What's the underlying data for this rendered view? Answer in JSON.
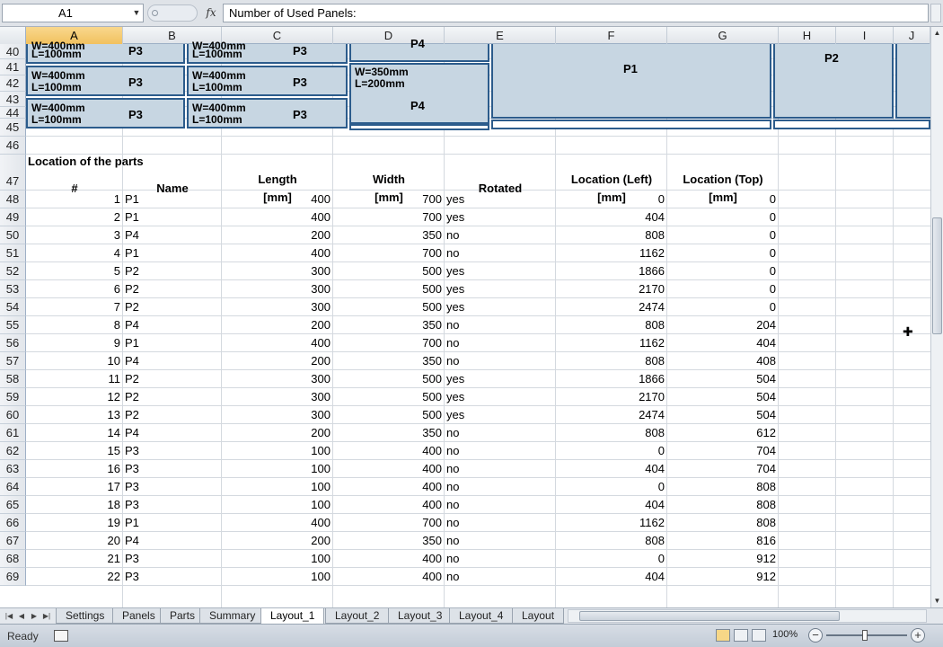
{
  "formula_bar": {
    "name_box": "A1",
    "fx_label": "fx",
    "formula": "Number of Used Panels:"
  },
  "columns": [
    "A",
    "B",
    "C",
    "D",
    "E",
    "F",
    "G",
    "H",
    "I",
    "J"
  ],
  "row_numbers": [
    "40",
    "41",
    "42",
    "43",
    "44",
    "45",
    "46",
    "47",
    "48",
    "49",
    "50",
    "51",
    "52",
    "53",
    "54",
    "55",
    "56",
    "57",
    "58",
    "59",
    "60",
    "61",
    "62",
    "63",
    "64",
    "65",
    "66",
    "67",
    "68",
    "69"
  ],
  "layout_panels": {
    "p3_dims": "W=400mm\nL=100mm",
    "p3_dims_top": "W=400mm",
    "p3_bottom": "L=100mm",
    "p3_label": "P3",
    "p4_dims": "W=350mm\nL=200mm",
    "p4_label": "P4",
    "p1_label": "P1",
    "p2_label": "P2"
  },
  "table": {
    "section_title": "Location of the parts",
    "headers": {
      "index": "#",
      "name": "Name",
      "length_line1": "Length",
      "length_line2": "[mm]",
      "width_line1": "Width",
      "width_line2": "[mm]",
      "rotated": "Rotated",
      "left_line1": "Location (Left)",
      "left_line2": "[mm]",
      "top_line1": "Location (Top)",
      "top_line2": "[mm]"
    },
    "rows": [
      {
        "n": "1",
        "name": "P1",
        "length": "400",
        "width": "700",
        "rotated": "yes",
        "left": "0",
        "top": "0"
      },
      {
        "n": "2",
        "name": "P1",
        "length": "400",
        "width": "700",
        "rotated": "yes",
        "left": "404",
        "top": "0"
      },
      {
        "n": "3",
        "name": "P4",
        "length": "200",
        "width": "350",
        "rotated": "no",
        "left": "808",
        "top": "0"
      },
      {
        "n": "4",
        "name": "P1",
        "length": "400",
        "width": "700",
        "rotated": "no",
        "left": "1162",
        "top": "0"
      },
      {
        "n": "5",
        "name": "P2",
        "length": "300",
        "width": "500",
        "rotated": "yes",
        "left": "1866",
        "top": "0"
      },
      {
        "n": "6",
        "name": "P2",
        "length": "300",
        "width": "500",
        "rotated": "yes",
        "left": "2170",
        "top": "0"
      },
      {
        "n": "7",
        "name": "P2",
        "length": "300",
        "width": "500",
        "rotated": "yes",
        "left": "2474",
        "top": "0"
      },
      {
        "n": "8",
        "name": "P4",
        "length": "200",
        "width": "350",
        "rotated": "no",
        "left": "808",
        "top": "204"
      },
      {
        "n": "9",
        "name": "P1",
        "length": "400",
        "width": "700",
        "rotated": "no",
        "left": "1162",
        "top": "404"
      },
      {
        "n": "10",
        "name": "P4",
        "length": "200",
        "width": "350",
        "rotated": "no",
        "left": "808",
        "top": "408"
      },
      {
        "n": "11",
        "name": "P2",
        "length": "300",
        "width": "500",
        "rotated": "yes",
        "left": "1866",
        "top": "504"
      },
      {
        "n": "12",
        "name": "P2",
        "length": "300",
        "width": "500",
        "rotated": "yes",
        "left": "2170",
        "top": "504"
      },
      {
        "n": "13",
        "name": "P2",
        "length": "300",
        "width": "500",
        "rotated": "yes",
        "left": "2474",
        "top": "504"
      },
      {
        "n": "14",
        "name": "P4",
        "length": "200",
        "width": "350",
        "rotated": "no",
        "left": "808",
        "top": "612"
      },
      {
        "n": "15",
        "name": "P3",
        "length": "100",
        "width": "400",
        "rotated": "no",
        "left": "0",
        "top": "704"
      },
      {
        "n": "16",
        "name": "P3",
        "length": "100",
        "width": "400",
        "rotated": "no",
        "left": "404",
        "top": "704"
      },
      {
        "n": "17",
        "name": "P3",
        "length": "100",
        "width": "400",
        "rotated": "no",
        "left": "0",
        "top": "808"
      },
      {
        "n": "18",
        "name": "P3",
        "length": "100",
        "width": "400",
        "rotated": "no",
        "left": "404",
        "top": "808"
      },
      {
        "n": "19",
        "name": "P1",
        "length": "400",
        "width": "700",
        "rotated": "no",
        "left": "1162",
        "top": "808"
      },
      {
        "n": "20",
        "name": "P4",
        "length": "200",
        "width": "350",
        "rotated": "no",
        "left": "808",
        "top": "816"
      },
      {
        "n": "21",
        "name": "P3",
        "length": "100",
        "width": "400",
        "rotated": "no",
        "left": "0",
        "top": "912"
      },
      {
        "n": "22",
        "name": "P3",
        "length": "100",
        "width": "400",
        "rotated": "no",
        "left": "404",
        "top": "912"
      }
    ]
  },
  "sheet_tabs": [
    "Settings",
    "Panels",
    "Parts",
    "Summary",
    "Layout_1",
    "Layout_2",
    "Layout_3",
    "Layout_4",
    "Layout"
  ],
  "active_tab": "Layout_1",
  "status_bar": {
    "status": "Ready",
    "zoom": "100%"
  },
  "colors": {
    "panel_fill": "#c7d6e2",
    "panel_border": "#2c5c8c",
    "selected_header": "#f1c15f"
  }
}
